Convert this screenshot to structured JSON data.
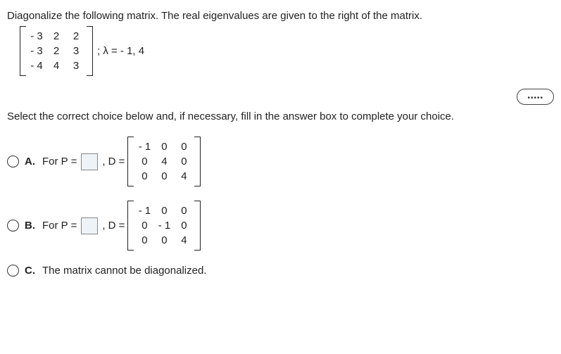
{
  "prompt": "Diagonalize the following matrix. The real eigenvalues are given to the right of the matrix.",
  "given_matrix": [
    [
      "- 3",
      "2",
      "2"
    ],
    [
      "- 3",
      "2",
      "3"
    ],
    [
      "- 4",
      "4",
      "3"
    ]
  ],
  "eigen_text": "; λ = - 1, 4",
  "instruction": "Select the correct choice below and, if necessary, fill in the answer box to complete your choice.",
  "choices": {
    "A": {
      "label": "A.",
      "for_p": "For P =",
      "d_eq": ", D =",
      "d_matrix": [
        [
          "- 1",
          "0",
          "0"
        ],
        [
          "0",
          "4",
          "0"
        ],
        [
          "0",
          "0",
          "4"
        ]
      ]
    },
    "B": {
      "label": "B.",
      "for_p": "For P =",
      "d_eq": ", D =",
      "d_matrix": [
        [
          "- 1",
          "0",
          "0"
        ],
        [
          "0",
          "- 1",
          "0"
        ],
        [
          "0",
          "0",
          "4"
        ]
      ]
    },
    "C": {
      "label": "C.",
      "text": "The matrix cannot be diagonalized."
    }
  }
}
